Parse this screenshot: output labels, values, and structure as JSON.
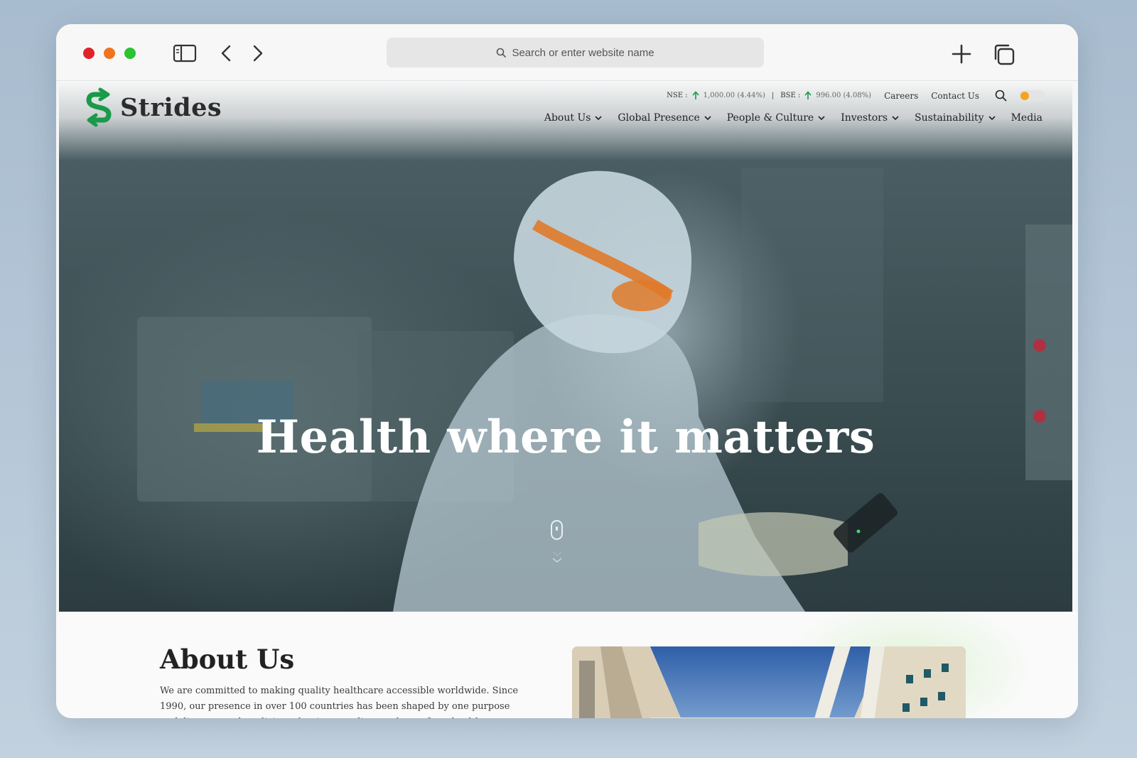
{
  "browser": {
    "traffic_lights": {
      "close": "#e0222b",
      "minimize": "#f0731e",
      "zoom": "#2bc32f"
    },
    "icons": [
      "sidebar-icon",
      "back-chevron-icon",
      "forward-chevron-icon",
      "search-icon",
      "new-tab-plus-icon",
      "tabs-overview-icon"
    ],
    "address_placeholder": "Search or enter website name"
  },
  "site": {
    "brand": "Strides",
    "brand_color": "#1a9a4a",
    "stocks": {
      "nse_label": "NSE :",
      "nse_value": "1,000.00 (4.44%)",
      "bse_label": "BSE :",
      "bse_value": "996.00 (4.08%)",
      "up_arrow_color": "#1a9a4a"
    },
    "utility_links": [
      "Careers",
      "Contact Us"
    ],
    "theme_toggle_color": "#f4a41c",
    "nav": [
      {
        "label": "About Us",
        "has_dropdown": true
      },
      {
        "label": "Global Presence",
        "has_dropdown": true
      },
      {
        "label": "People & Culture",
        "has_dropdown": true
      },
      {
        "label": "Investors",
        "has_dropdown": true
      },
      {
        "label": "Sustainability",
        "has_dropdown": true
      },
      {
        "label": "Media",
        "has_dropdown": false
      }
    ],
    "hero": {
      "headline": "Health where it matters"
    },
    "about": {
      "title": "About Us",
      "text": "We are committed to making quality healthcare accessible worldwide. Since 1990, our presence in over 100 countries has been shaped by one purpose to deliver trusted medicines that improve lives and transform health."
    }
  }
}
